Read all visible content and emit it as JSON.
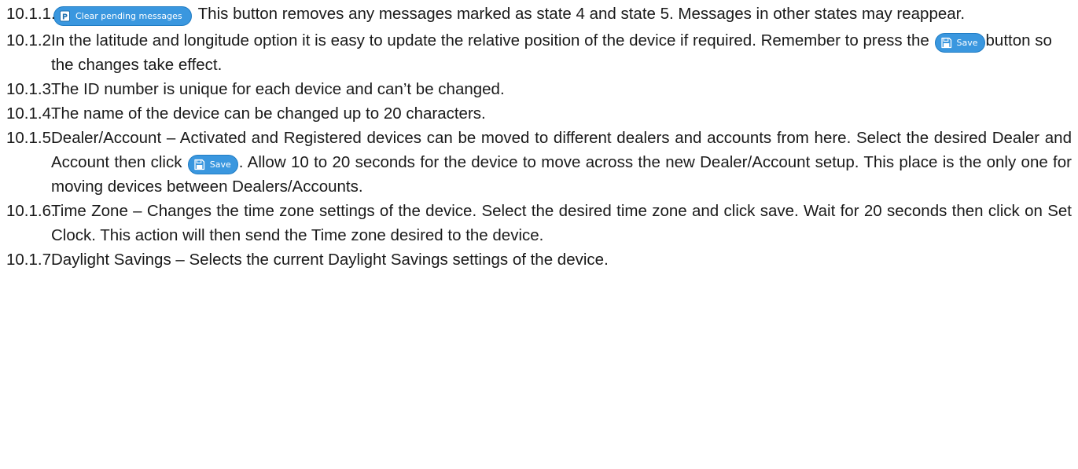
{
  "items": [
    {
      "num": "10.1.1.",
      "button": {
        "label": "Clear pending messages",
        "icon": "pending-page-icon"
      },
      "text": "This button removes any messages marked as state 4 and state 5. Messages in other states may reappear."
    },
    {
      "num": "10.1.2.",
      "text_before": "In the latitude and longitude option it is easy to update the relative position of the device if required. Remember to press the",
      "button": {
        "label": "Save",
        "icon": "floppy-disk-icon"
      },
      "text_after": "button so the changes take effect."
    },
    {
      "num": "10.1.3.",
      "text": "The ID number is unique for each device and can’t be changed."
    },
    {
      "num": "10.1.4.",
      "text": "The name of the device can be changed up to 20 characters."
    },
    {
      "num": "10.1.5.",
      "text_before": "Dealer/Account – Activated and Registered devices can be moved to different dealers and accounts from here. Select the desired Dealer and Account then click",
      "button": {
        "label": "Save",
        "icon": "floppy-disk-icon"
      },
      "text_after": ". Allow 10 to 20 seconds for the device to move across the new Dealer/Account setup. This place is the only one for moving devices between Dealers/Accounts."
    },
    {
      "num": "10.1.6.",
      "text": "Time Zone – Changes the time zone settings of the device. Select the desired time zone and click save. Wait for 20 seconds then click on Set Clock. This action will then send the Time zone desired to the device."
    },
    {
      "num": "10.1.7.",
      "text": "Daylight Savings – Selects the current Daylight Savings settings of the device."
    }
  ],
  "colors": {
    "button_fill": "#3a97df",
    "button_border": "#1f7cc4",
    "text": "#1a1a1a"
  }
}
